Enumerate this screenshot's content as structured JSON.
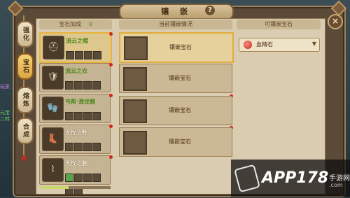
{
  "window": {
    "title": "镶 嵌",
    "help": "?",
    "close": "×"
  },
  "side_tabs": [
    {
      "label": "强化",
      "active": false
    },
    {
      "label": "宝石",
      "active": true
    },
    {
      "label": "熔炼",
      "active": false
    },
    {
      "label": "合成",
      "active": false
    }
  ],
  "headers": {
    "gem_bonus": "宝石加成",
    "gem_bonus_count": "0",
    "current": "当前镶嵌情况",
    "available": "可镶嵌宝石"
  },
  "equipment": [
    {
      "name": "流云之帽",
      "icon": "helmet-icon",
      "glyph": "⛑",
      "selected": true,
      "name_style": "green",
      "slots": [
        "empty",
        "empty",
        "empty",
        "empty",
        "empty",
        "empty"
      ]
    },
    {
      "name": "流云之衣",
      "icon": "armor-icon",
      "glyph": "🛡",
      "selected": false,
      "name_style": "green",
      "slots": [
        "empty",
        "empty",
        "empty",
        "empty",
        "empty",
        "empty"
      ]
    },
    {
      "name": "丐帮·潜龙腕",
      "icon": "bracer-icon",
      "glyph": "🧤",
      "selected": false,
      "name_style": "green",
      "slots": [
        "empty",
        "empty",
        "empty",
        "empty",
        "empty",
        "empty"
      ]
    },
    {
      "name": "无忧之靴",
      "icon": "boots-icon",
      "glyph": "👢",
      "selected": false,
      "name_style": "plain",
      "slots": [
        "empty",
        "empty",
        "empty",
        "empty",
        "empty",
        "empty"
      ]
    },
    {
      "name": "无忧之腕",
      "icon": "bracelet-icon",
      "glyph": "⌇",
      "selected": false,
      "name_style": "plain",
      "slots": [
        "green",
        "empty",
        "empty",
        "empty",
        "empty",
        "empty"
      ]
    }
  ],
  "sockets": [
    {
      "label": "镶嵌宝石",
      "selected": true
    },
    {
      "label": "镶嵌宝石",
      "selected": false
    },
    {
      "label": "镶嵌宝石",
      "selected": false
    },
    {
      "label": "镶嵌宝石",
      "selected": false
    }
  ],
  "gem_select": {
    "value": "血精石",
    "icon": "red-gem-icon"
  },
  "progress": {
    "value": 0.4
  },
  "left_hud": [
    "玩家",
    "元宝",
    "二转"
  ],
  "watermark": {
    "brand": "APP178",
    "cn": "手游网",
    "url": ".com"
  },
  "colors": {
    "accent": "#e9b33d",
    "red_dot": "#d3251c",
    "green_name": "#4f8a1c"
  }
}
